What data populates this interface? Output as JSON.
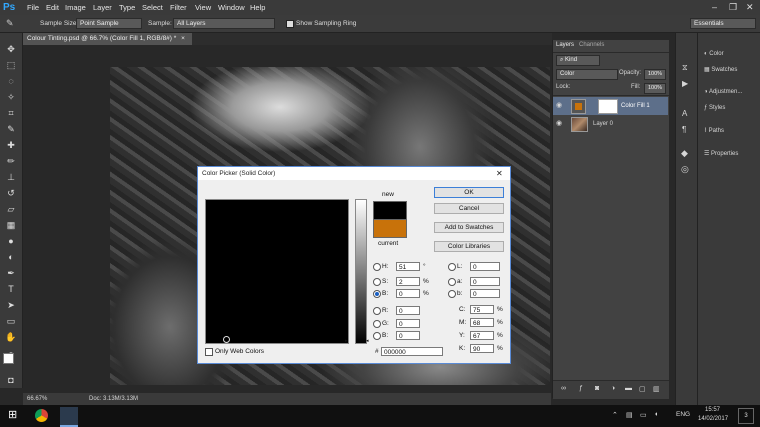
{
  "app": {
    "logo": "Ps"
  },
  "menu": [
    "File",
    "Edit",
    "Image",
    "Layer",
    "Type",
    "Select",
    "Filter",
    "View",
    "Window",
    "Help"
  ],
  "window_controls": [
    "–",
    "❐",
    "✕"
  ],
  "options_bar": {
    "sample_size_label": "Sample Size:",
    "sample_size_value": "Point Sample",
    "sample_label": "Sample:",
    "sample_value": "All Layers",
    "sampling_ring_label": "Show Sampling Ring",
    "workspace": "Essentials"
  },
  "document_tab": {
    "title": "Colour Tinting.psd @ 66.7% (Color Fill 1, RGB/8#) *",
    "close": "×"
  },
  "status_bar": {
    "zoom": "66.67%",
    "doc": "Doc: 3.13M/3.13M"
  },
  "layers_panel": {
    "tabs": [
      "Layers",
      "Channels"
    ],
    "kind_label": "Kind",
    "blend_mode": "Color",
    "opacity_label": "Opacity:",
    "opacity_value": "100%",
    "lock_label": "Lock:",
    "fill_label": "Fill:",
    "fill_value": "100%",
    "layers": [
      {
        "name": "Color Fill 1",
        "selected": true
      },
      {
        "name": "Layer 0",
        "selected": false
      }
    ]
  },
  "right_panels": [
    "Color",
    "Swatches",
    "Adjustmen...",
    "Styles",
    "Paths",
    "Properties"
  ],
  "color_picker": {
    "title": "Color Picker (Solid Color)",
    "new_label": "new",
    "current_label": "current",
    "new_color": "#000000",
    "current_color": "#c8720a",
    "buttons": {
      "ok": "OK",
      "cancel": "Cancel",
      "add_swatches": "Add to Swatches",
      "libraries": "Color Libraries"
    },
    "only_web_colors": "Only Web Colors",
    "hsb": {
      "h_label": "H:",
      "h": "51",
      "h_unit": "°",
      "s_label": "S:",
      "s": "2",
      "s_unit": "%",
      "b_label": "B:",
      "b": "0",
      "b_unit": "%"
    },
    "rgb": {
      "r_label": "R:",
      "r": "0",
      "g_label": "G:",
      "g": "0",
      "b_label": "B:",
      "b": "0"
    },
    "lab": {
      "l_label": "L:",
      "l": "0",
      "a_label": "a:",
      "a": "0",
      "b_label": "b:",
      "b": "0"
    },
    "cmyk": {
      "c_label": "C:",
      "c": "75",
      "m_label": "M:",
      "m": "68",
      "y_label": "Y:",
      "y": "67",
      "k_label": "K:",
      "k": "90",
      "unit": "%"
    },
    "hex_label": "#",
    "hex": "000000"
  },
  "taskbar": {
    "lang": "ENG",
    "time": "15:57",
    "date": "14/02/2017",
    "notif": "3"
  }
}
